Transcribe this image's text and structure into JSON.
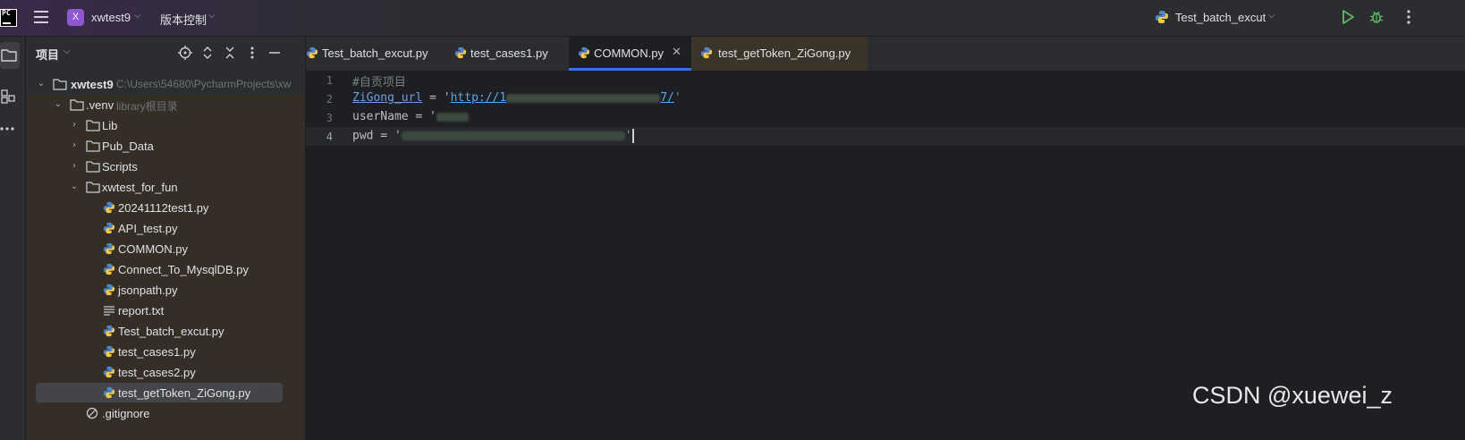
{
  "titlebar": {
    "project_badge": "X",
    "project_name": "xwtest9",
    "vcs_label": "版本控制",
    "run_config": "Test_batch_excut"
  },
  "project_panel": {
    "title": "项目",
    "tree": [
      {
        "label": "xwtest9",
        "hint": "C:\\Users\\54680\\PycharmProjects\\xw",
        "type": "folder",
        "expanded": true
      },
      {
        "label": ".venv",
        "hint": "library根目录",
        "type": "folder",
        "expanded": true
      },
      {
        "label": "Lib",
        "type": "folder",
        "expanded": false
      },
      {
        "label": "Pub_Data",
        "type": "folder",
        "expanded": false
      },
      {
        "label": "Scripts",
        "type": "folder",
        "expanded": false
      },
      {
        "label": "xwtest_for_fun",
        "type": "folder",
        "expanded": true
      },
      {
        "label": "20241112test1.py",
        "type": "python"
      },
      {
        "label": "API_test.py",
        "type": "python"
      },
      {
        "label": "COMMON.py",
        "type": "python"
      },
      {
        "label": "Connect_To_MysqlDB.py",
        "type": "python"
      },
      {
        "label": "jsonpath.py",
        "type": "python"
      },
      {
        "label": "report.txt",
        "type": "text"
      },
      {
        "label": "Test_batch_excut.py",
        "type": "python"
      },
      {
        "label": "test_cases1.py",
        "type": "python"
      },
      {
        "label": "test_cases2.py",
        "type": "python"
      },
      {
        "label": "test_getToken_ZiGong.py",
        "type": "python",
        "selected": true
      },
      {
        "label": ".gitignore",
        "type": "ignore"
      }
    ]
  },
  "tabs": [
    {
      "label": "Test_batch_excut.py"
    },
    {
      "label": "test_cases1.py"
    },
    {
      "label": "COMMON.py",
      "active": true,
      "close": "✕"
    },
    {
      "label": "test_getToken_ZiGong.py"
    }
  ],
  "editor": {
    "line_numbers": [
      "1",
      "2",
      "3",
      "4"
    ],
    "line1_comment": "#自贡项目",
    "line2_var": "ZiGong_url",
    "line2_eq": " = '",
    "line2_str_a": "http://1",
    "line2_str_b": "7/",
    "line2_end": "'",
    "line3_a": "userName = '",
    "line4_a": "pwd = '",
    "line4_end": "'"
  },
  "watermark": "CSDN @xuewei_z",
  "colors": {
    "accent": "#3574f0",
    "badge": "#8f57d1",
    "run_green": "#5fb865"
  }
}
